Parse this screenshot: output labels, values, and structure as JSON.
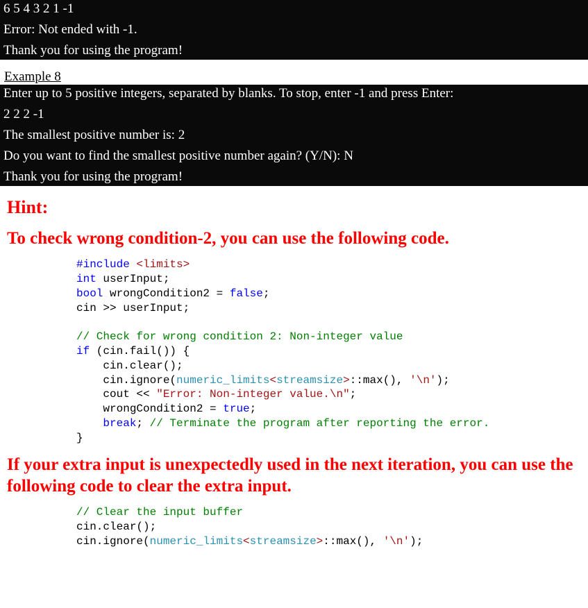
{
  "console1": {
    "line1": "6 5 4 3 2 1 -1",
    "line2": "Error: Not ended with -1.",
    "line3": "Thank you for using the program!"
  },
  "example_heading": "Example 8",
  "console2": {
    "line1": "Enter up to 5 positive integers, separated by blanks. To stop, enter -1 and press Enter:",
    "line2": "2 2 2 -1",
    "line3": "The smallest positive number is: 2",
    "line4": "Do you want to find the smallest positive number again? (Y/N): N",
    "line5": "Thank you for using the program!"
  },
  "hint_heading": "Hint:",
  "hint_text1": "To check wrong condition-2, you can use the following code.",
  "code1": {
    "l1a": "#include ",
    "l1b": "<limits>",
    "l2a": "int",
    "l2b": " userInput;",
    "l3a": "bool",
    "l3b": " wrongCondition2 = ",
    "l3c": "false",
    "l3d": ";",
    "l4": "cin >> userInput;",
    "l5": "// Check for wrong condition 2: Non-integer value",
    "l6a": "if",
    "l6b": " (cin.fail()) {",
    "l7": "    cin.clear();",
    "l8a": "    cin.ignore(",
    "l8b": "numeric_limits",
    "l8c": "<",
    "l8d": "streamsize",
    "l8e": ">",
    "l8f": "::max(), ",
    "l8g": "'\\n'",
    "l8h": ");",
    "l9a": "    cout << ",
    "l9b": "\"Error: Non-integer value.\\n\"",
    "l9c": ";",
    "l10a": "    wrongCondition2 = ",
    "l10b": "true",
    "l10c": ";",
    "l11a": "    ",
    "l11b": "break",
    "l11c": "; ",
    "l11d": "// Terminate the program after reporting the error.",
    "l12": "}"
  },
  "hint_text2": "If your extra input is unexpectedly used in the next iteration, you can use the following code to clear the extra input.",
  "code2": {
    "l1": "// Clear the input buffer",
    "l2": "cin.clear();",
    "l3a": "cin.ignore(",
    "l3b": "numeric_limits",
    "l3c": "<",
    "l3d": "streamsize",
    "l3e": ">",
    "l3f": "::max(), ",
    "l3g": "'\\n'",
    "l3h": ");"
  }
}
